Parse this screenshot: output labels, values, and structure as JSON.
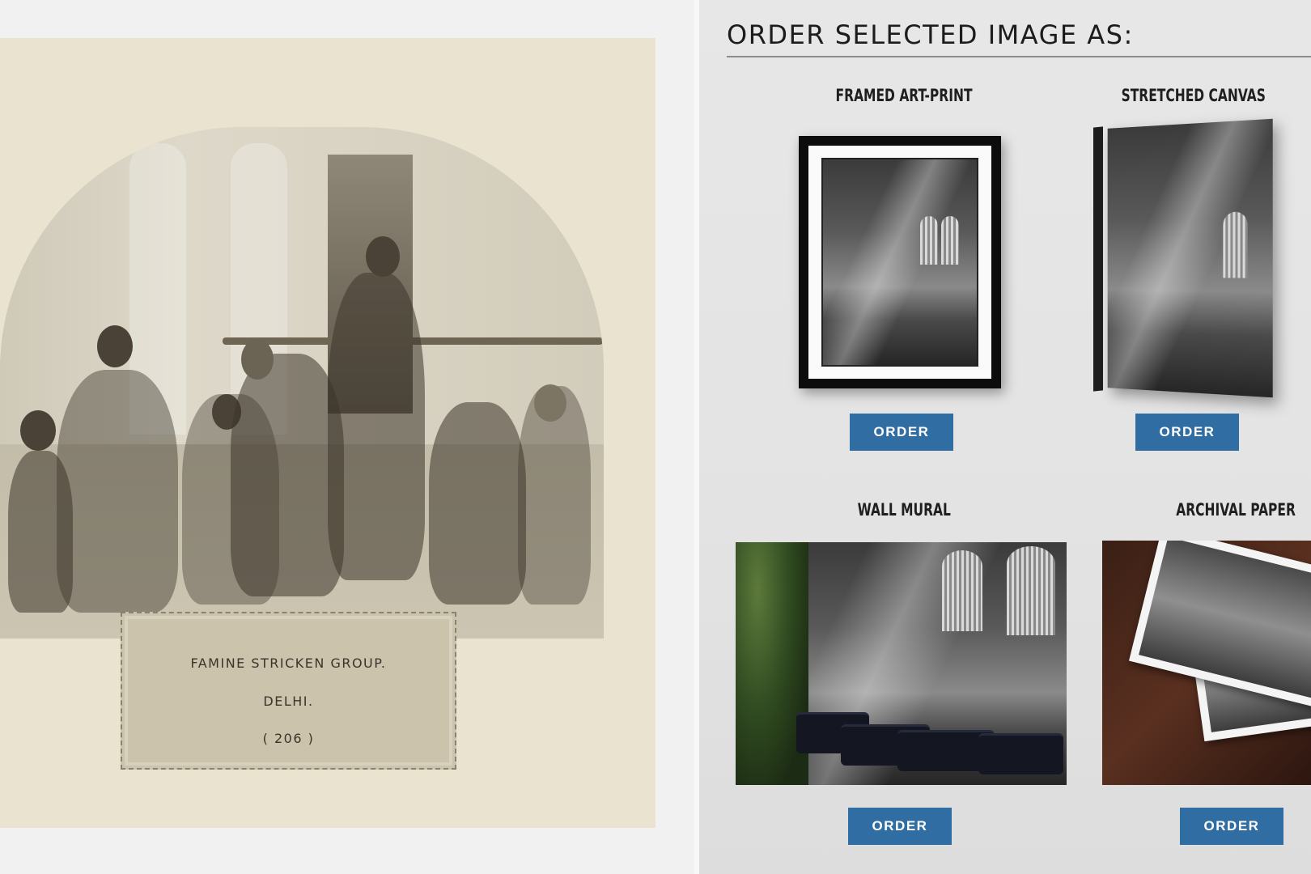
{
  "photo_label": {
    "line1": "FAMINE STRICKEN GROUP.",
    "line2": "DELHI.",
    "line3": "( 206 )"
  },
  "order_panel": {
    "heading": "ORDER SELECTED IMAGE AS:",
    "products": [
      {
        "title": "FRAMED ART-PRINT",
        "button": "ORDER"
      },
      {
        "title": "STRETCHED CANVAS",
        "button": "ORDER"
      },
      {
        "title": "WALL MURAL",
        "button": "ORDER"
      },
      {
        "title": "ARCHIVAL PAPER",
        "button": "ORDER"
      }
    ]
  },
  "colors": {
    "button": "#2f6da3",
    "panel_background": "#e5e5e5",
    "album_page": "#e9e3d0"
  }
}
